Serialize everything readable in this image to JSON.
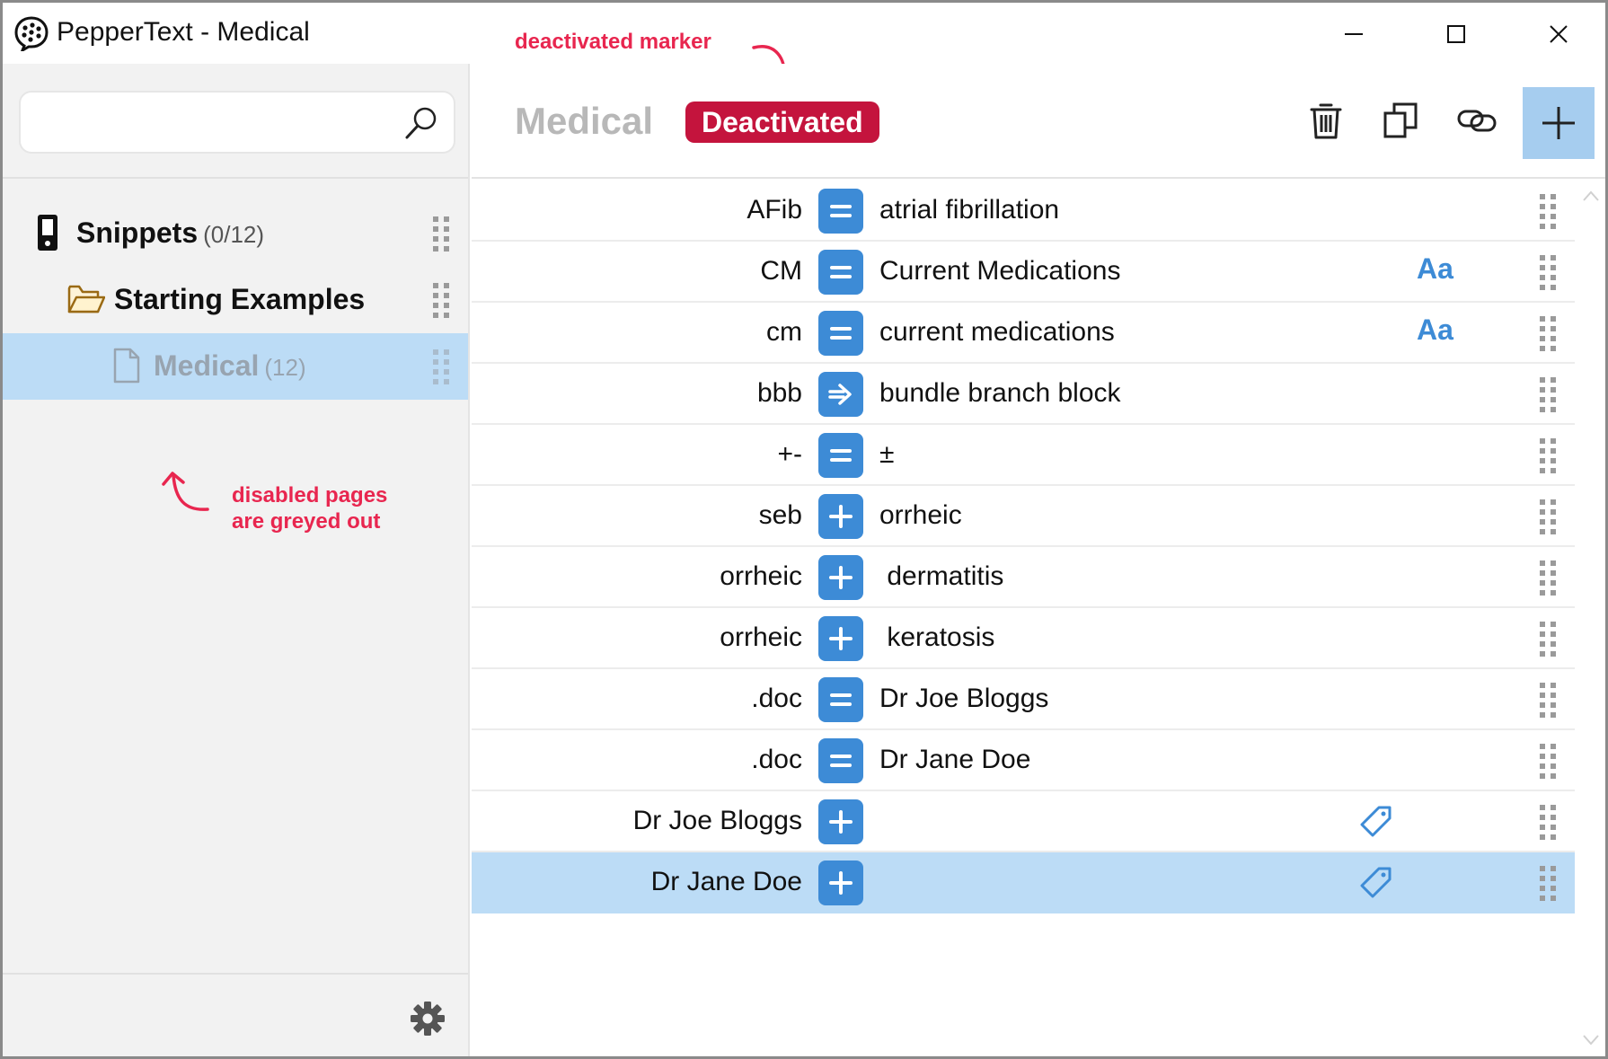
{
  "window": {
    "title": "PepperText - Medical",
    "controls": [
      "minimize",
      "maximize",
      "close"
    ]
  },
  "annotations": {
    "top": "deactivated marker",
    "side_line1": "disabled pages",
    "side_line2": "are greyed out"
  },
  "sidebar": {
    "search": {
      "value": "",
      "placeholder": ""
    },
    "tree": [
      {
        "label": "Snippets",
        "count": "(0/12)",
        "icon": "phone-icon",
        "level": 0,
        "selected": false,
        "disabled": false
      },
      {
        "label": "Starting Examples",
        "count": "",
        "icon": "folder-open-icon",
        "level": 1,
        "selected": false,
        "disabled": false
      },
      {
        "label": "Medical",
        "count": "(12)",
        "icon": "page-icon",
        "level": 2,
        "selected": true,
        "disabled": true
      }
    ],
    "settings_icon": "gear-icon"
  },
  "main": {
    "title": "Medical",
    "status_badge": "Deactivated",
    "toolbar": [
      "trash-icon",
      "copy-icon",
      "link-icon",
      "plus-icon"
    ],
    "colors": {
      "accent": "#3d8bd6",
      "badge": "#c4143d",
      "selected": "#bcdcf6",
      "annotation": "#e8264f"
    },
    "snippets": [
      {
        "abbr": "AFib",
        "op": "equals",
        "text": "atrial fibrillation",
        "case": false,
        "tag": false,
        "selected": false
      },
      {
        "abbr": "CM",
        "op": "equals",
        "text": "Current Medications",
        "case": true,
        "tag": false,
        "selected": false
      },
      {
        "abbr": "cm",
        "op": "equals",
        "text": "current medications",
        "case": true,
        "tag": false,
        "selected": false
      },
      {
        "abbr": "bbb",
        "op": "arrow",
        "text": "bundle branch block",
        "case": false,
        "tag": false,
        "selected": false
      },
      {
        "abbr": "+-",
        "op": "equals",
        "text": "±",
        "case": false,
        "tag": false,
        "selected": false
      },
      {
        "abbr": "seb",
        "op": "plus",
        "text": "orrheic",
        "case": false,
        "tag": false,
        "selected": false
      },
      {
        "abbr": "orrheic",
        "op": "plus",
        "text": " dermatitis",
        "case": false,
        "tag": false,
        "selected": false
      },
      {
        "abbr": "orrheic",
        "op": "plus",
        "text": " keratosis",
        "case": false,
        "tag": false,
        "selected": false
      },
      {
        "abbr": ".doc",
        "op": "equals",
        "text": "Dr Joe Bloggs",
        "case": false,
        "tag": false,
        "selected": false
      },
      {
        "abbr": ".doc",
        "op": "equals",
        "text": "Dr Jane Doe",
        "case": false,
        "tag": false,
        "selected": false
      },
      {
        "abbr": "Dr Joe Bloggs",
        "op": "plus",
        "text": "",
        "case": false,
        "tag": true,
        "selected": false
      },
      {
        "abbr": "Dr Jane Doe",
        "op": "plus",
        "text": "",
        "case": false,
        "tag": true,
        "selected": true
      }
    ],
    "case_label": "Aa"
  }
}
